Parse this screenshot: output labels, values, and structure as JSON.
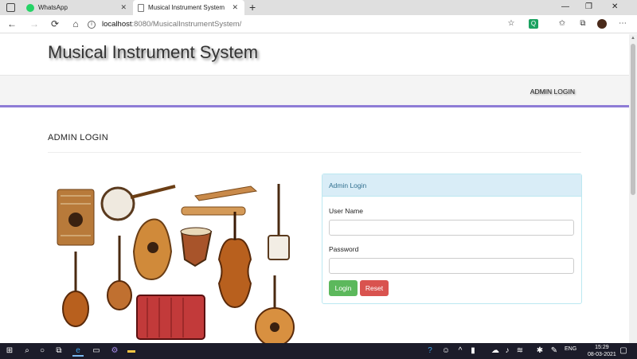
{
  "browser": {
    "tabs": [
      {
        "title": "WhatsApp",
        "active": false,
        "icon_color": "#25D366"
      },
      {
        "title": "Musical Instrument System",
        "active": true
      }
    ],
    "url_host": "localhost",
    "url_rest": ":8080/MusicalInstrumentSystem/"
  },
  "site": {
    "title": "Musical Instrument System",
    "nav_admin_login": "ADMIN LOGIN",
    "accent_color": "#8e7cd6"
  },
  "page": {
    "section_title": "ADMIN LOGIN"
  },
  "illustration_labels": [
    "zither",
    "american banjo",
    "reed pipe",
    "flute",
    "balalaika",
    "indian sitar",
    "ukrainian bandura",
    "african djembe drum",
    "italian viola",
    "japanese shamisen",
    "rebec",
    "accordion"
  ],
  "form": {
    "heading": "Admin Login",
    "username_label": "User Name",
    "username_value": "",
    "password_label": "Password",
    "password_value": "",
    "login_button": "Login",
    "reset_button": "Reset"
  },
  "taskbar": {
    "language": "ENG",
    "time": "15:29",
    "date": "08-03-2021"
  }
}
